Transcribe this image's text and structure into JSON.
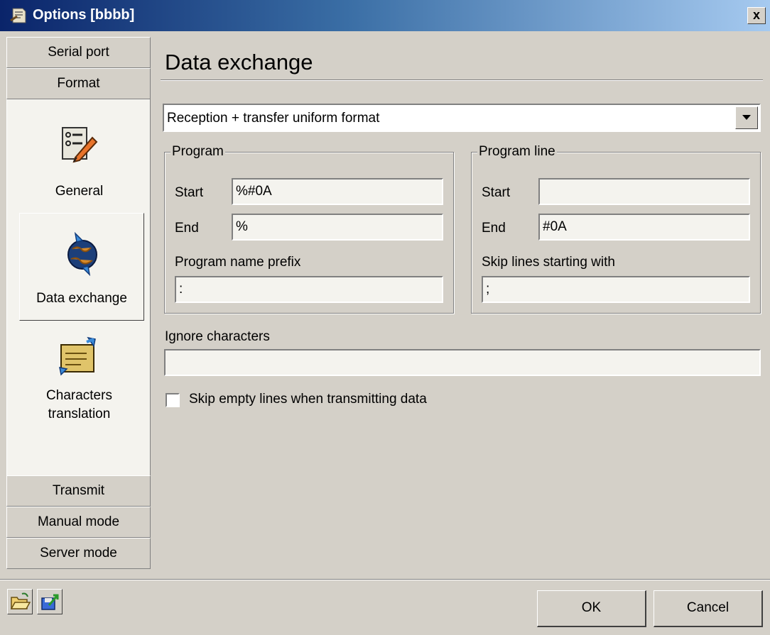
{
  "window": {
    "title": "Options [bbbb]",
    "close_label": "x"
  },
  "nav": {
    "top_buttons": [
      {
        "label": "Serial port"
      },
      {
        "label": "Format"
      }
    ],
    "items": [
      {
        "label": "General",
        "icon": "checklist-pen-icon"
      },
      {
        "label": "Data exchange",
        "icon": "globe-arrows-icon",
        "selected": true
      },
      {
        "label_line1": "Characters",
        "label_line2": "translation",
        "icon": "document-arrows-icon"
      }
    ],
    "bottom_buttons": [
      {
        "label": "Transmit"
      },
      {
        "label": "Manual mode"
      },
      {
        "label": "Server mode"
      }
    ]
  },
  "main": {
    "heading": "Data exchange",
    "mode_select": {
      "value": "Reception + transfer uniform format"
    },
    "program_group": {
      "title": "Program",
      "start_label": "Start",
      "start_value": "%#0A",
      "end_label": "End",
      "end_value": "%",
      "prefix_label": "Program name prefix",
      "prefix_value": ":"
    },
    "program_line_group": {
      "title": "Program line",
      "start_label": "Start",
      "start_value": "",
      "end_label": "End",
      "end_value": "#0A",
      "skip_label": "Skip lines starting with",
      "skip_value": ";"
    },
    "ignore_label": "Ignore characters",
    "ignore_value": "",
    "skip_empty_label": "Skip empty lines when transmitting data",
    "skip_empty_checked": false
  },
  "footer": {
    "ok_label": "OK",
    "cancel_label": "Cancel",
    "tools": [
      {
        "icon": "open-folder-icon"
      },
      {
        "icon": "save-export-icon"
      }
    ]
  }
}
